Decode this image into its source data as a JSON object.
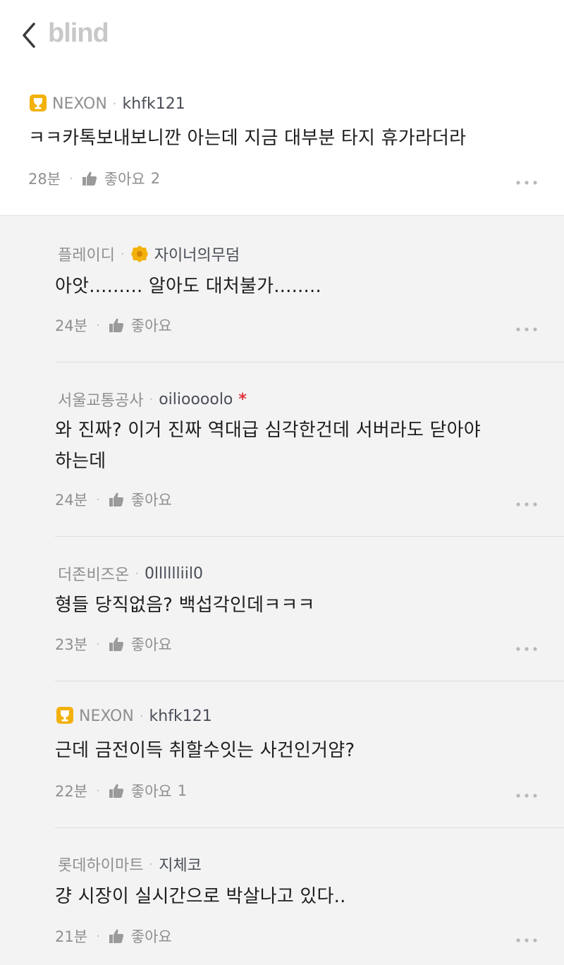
{
  "app": {
    "logo": "blind"
  },
  "main_comment": {
    "company": "NEXON",
    "username": "khfk121",
    "text": "ㅋㅋ카톡보내보니깐 아는데 지금 대부분 타지 휴가라더라",
    "time": "28분",
    "like_label": "좋아요",
    "like_count": "2"
  },
  "replies": [
    {
      "company": "플레이디",
      "username": "자이너의무덤",
      "text_lines": [
        "아앗......... 알아도 대처불가........"
      ],
      "time": "24분",
      "like_label": "좋아요",
      "like_count": ""
    },
    {
      "company": "서울교통공사",
      "username": "oilioooolo",
      "star": "*",
      "text_lines": [
        "와 진짜? 이거 진짜 역대급 심각한건데 서버라도 닫아야",
        "하는데"
      ],
      "time": "24분",
      "like_label": "좋아요",
      "like_count": ""
    },
    {
      "company": "더존비즈온",
      "username": "0lllllliil0",
      "text_lines": [
        "형들 당직없음? 백섭각인데ㅋㅋㅋ"
      ],
      "time": "23분",
      "like_label": "좋아요",
      "like_count": ""
    },
    {
      "company": "NEXON",
      "username": "khfk121",
      "text_lines": [
        "근데 금전이득 취할수잇는 사건인거얌?"
      ],
      "time": "22분",
      "like_label": "좋아요",
      "like_count": "1"
    },
    {
      "company": "롯데하이마트",
      "username": "지체코",
      "text_lines": [
        "걍 시장이 실시간으로 박살나고 있다.."
      ],
      "time": "21분",
      "like_label": "좋아요",
      "like_count": ""
    }
  ],
  "icons": {
    "back": "chevron-left-icon",
    "badge": "trophy-badge-icon",
    "developer": "gear-badge-icon",
    "like": "thumbs-up-icon",
    "more": "more-dots-icon"
  },
  "colors": {
    "badge": "#f2b10c",
    "star": "#e0303c",
    "reply_bg": "#f3f3f3"
  }
}
